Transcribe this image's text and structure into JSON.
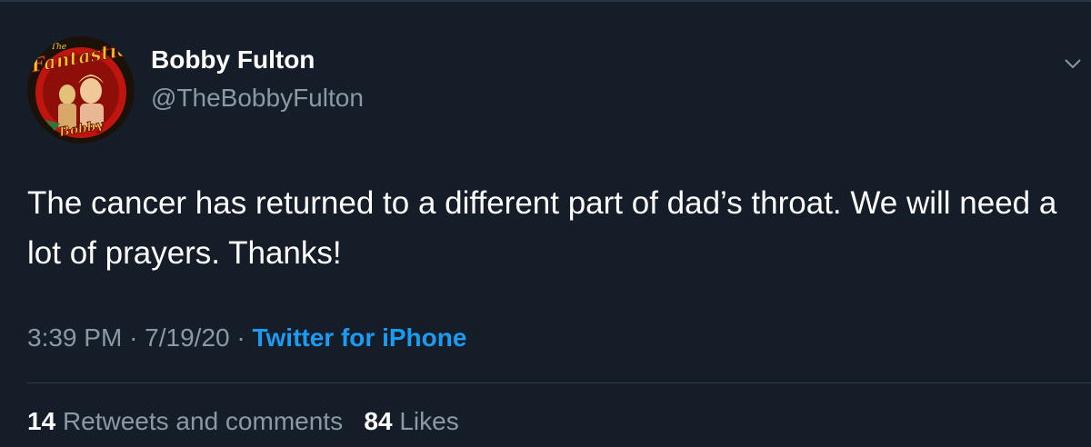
{
  "user": {
    "display_name": "Bobby Fulton",
    "handle": "@TheBobbyFulton",
    "avatar": {
      "label_top": "The",
      "label_main": "Fantastic",
      "label_bottom": "Bobby"
    }
  },
  "tweet": {
    "text": "The cancer has returned to a different part of dad’s throat. We will need a lot of prayers. Thanks!",
    "time": "3:39 PM",
    "separator": "·",
    "date": "7/19/20",
    "source": "Twitter for iPhone"
  },
  "stats": {
    "retweets_count": "14",
    "retweets_label": "Retweets and comments",
    "likes_count": "84",
    "likes_label": "Likes"
  },
  "icons": {
    "menu": "chevron-down-icon"
  },
  "colors": {
    "background": "#151d29",
    "text": "#ffffff",
    "secondary": "#8b98a5",
    "link": "#1d9bf0"
  }
}
